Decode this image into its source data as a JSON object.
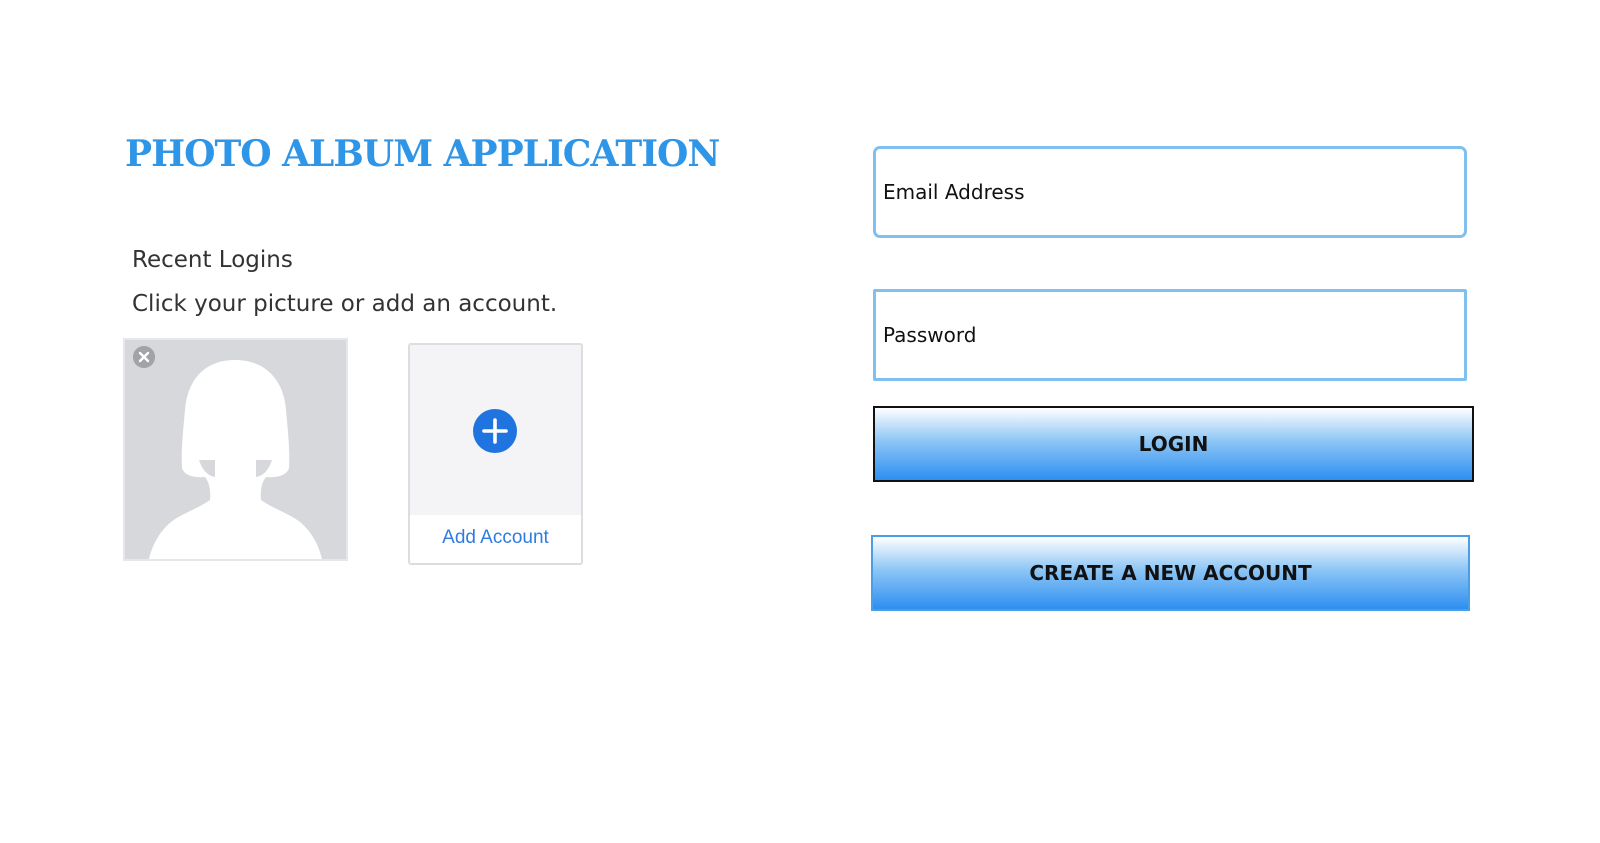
{
  "app": {
    "title": "PHOTO ALBUM APPLICATION",
    "accent_color": "#2f95e6"
  },
  "recent_logins": {
    "heading": "Recent Logins",
    "instruction": "Click your picture or add an account.",
    "profiles": [
      {
        "avatar": "default-female-silhouette",
        "remove_icon": "close-icon"
      }
    ],
    "add_account": {
      "label": "Add Account",
      "icon": "plus-circle-icon"
    }
  },
  "login_form": {
    "email": {
      "placeholder": "Email Address",
      "value": ""
    },
    "password": {
      "placeholder": "Password",
      "value": ""
    },
    "login_label": "LOGIN",
    "create_account_label": "CREATE A NEW ACCOUNT",
    "button_gradient": [
      "#ffffff",
      "#8ec6f5",
      "#2d8ff0"
    ]
  }
}
